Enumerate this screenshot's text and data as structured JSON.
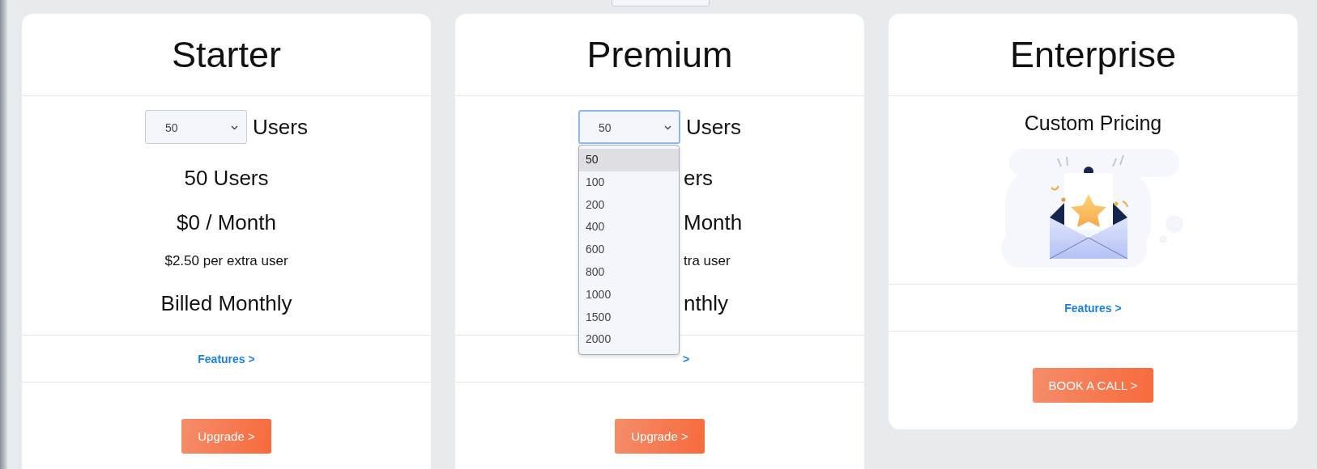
{
  "plans": [
    {
      "kind": "priced",
      "title": "Starter",
      "users_select": {
        "value": "50",
        "focused": false
      },
      "users_label": "Users",
      "users_count": "50 Users",
      "price": "$0 / Month",
      "extra": "$2.50 per extra user",
      "billing": "Billed Monthly",
      "features_link": "Features >",
      "button": "Upgrade >"
    },
    {
      "kind": "priced",
      "title": "Premium",
      "users_select": {
        "value": "50",
        "focused": true
      },
      "users_label": "Users",
      "users_count": "ers",
      "price": "Month",
      "extra": "tra user",
      "billing": "nthly",
      "features_link": ">",
      "button": "Upgrade >",
      "dropdown": {
        "open": true,
        "options": [
          {
            "label": "50",
            "selected": true
          },
          {
            "label": "100",
            "selected": false
          },
          {
            "label": "200",
            "selected": false
          },
          {
            "label": "400",
            "selected": false
          },
          {
            "label": "600",
            "selected": false
          },
          {
            "label": "800",
            "selected": false
          },
          {
            "label": "1000",
            "selected": false
          },
          {
            "label": "1500",
            "selected": false
          },
          {
            "label": "2000",
            "selected": false
          }
        ]
      }
    },
    {
      "kind": "custom",
      "title": "Enterprise",
      "pricing": "Custom Pricing",
      "features_link": "Features >",
      "button": "BOOK A CALL >"
    }
  ]
}
